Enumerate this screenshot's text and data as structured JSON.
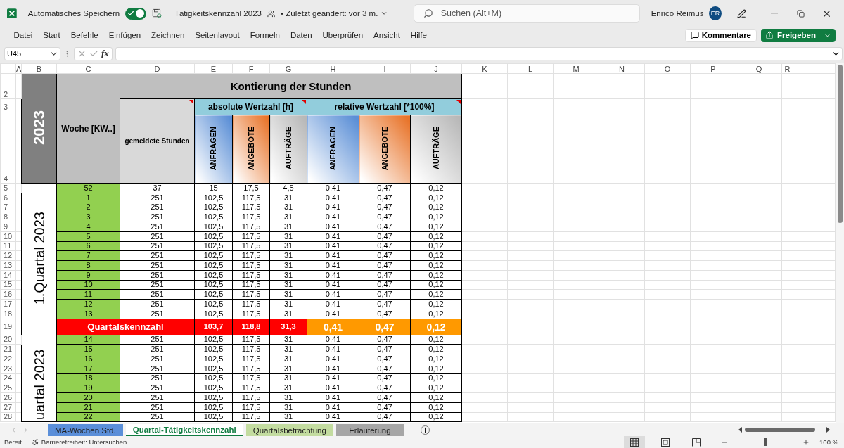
{
  "app": {
    "autosave_label": "Automatisches Speichern",
    "autosave_on": true,
    "document_title": "Tätigkeitskennzahl 2023",
    "modified": "• Zuletzt geändert: vor 3 m.",
    "search_placeholder": "Suchen (Alt+M)",
    "user_name": "Enrico Reimus",
    "user_initials": "ER"
  },
  "menu": [
    "Datei",
    "Start",
    "Befehle",
    "Einfügen",
    "Zeichnen",
    "Seitenlayout",
    "Formeln",
    "Daten",
    "Überprüfen",
    "Ansicht",
    "Hilfe"
  ],
  "ribbon_buttons": {
    "comments": "Kommentare",
    "share": "Freigeben"
  },
  "formula_bar": {
    "name_box": "U45",
    "function_label": "fx"
  },
  "column_headers": [
    "A",
    "B",
    "C",
    "D",
    "E",
    "F",
    "G",
    "H",
    "I",
    "J",
    "K",
    "L",
    "M",
    "N",
    "O",
    "P",
    "Q",
    "R"
  ],
  "sheet": {
    "header_rows": [
      "2",
      "3",
      "4"
    ],
    "year": "2023",
    "week_header": "Woche [KW..]",
    "title": "Kontierung der Stunden",
    "reported_header": {
      "label": "gemeldete Stunden",
      "comment": true
    },
    "group_headers": [
      {
        "label": "absolute Wertzahl [h]",
        "comment": true
      },
      {
        "label": "relative Wertzahl [*100%]",
        "comment": true
      }
    ],
    "sub_headers": [
      {
        "label": "ANFRAGEN",
        "kind": "blue"
      },
      {
        "label": "ANGEBOTE",
        "kind": "orange"
      },
      {
        "label": "AUFTRÄGE",
        "kind": "gray"
      },
      {
        "label": "ANFRAGEN",
        "kind": "blue"
      },
      {
        "label": "ANGEBOTE",
        "kind": "orange"
      },
      {
        "label": "AUFTRÄGE",
        "kind": "gray"
      }
    ],
    "quarters": [
      {
        "label": "1.Quartal 2023",
        "rows": [
          {
            "row": "5",
            "week": "52",
            "reported": "37",
            "values": [
              "15",
              "17,5",
              "4,5",
              "0,41",
              "0,47",
              "0,12"
            ]
          },
          {
            "row": "6",
            "week": "1",
            "reported": "251",
            "values": [
              "102,5",
              "117,5",
              "31",
              "0,41",
              "0,47",
              "0,12"
            ]
          },
          {
            "row": "7",
            "week": "2",
            "reported": "251",
            "values": [
              "102,5",
              "117,5",
              "31",
              "0,41",
              "0,47",
              "0,12"
            ]
          },
          {
            "row": "8",
            "week": "3",
            "reported": "251",
            "values": [
              "102,5",
              "117,5",
              "31",
              "0,41",
              "0,47",
              "0,12"
            ]
          },
          {
            "row": "9",
            "week": "4",
            "reported": "251",
            "values": [
              "102,5",
              "117,5",
              "31",
              "0,41",
              "0,47",
              "0,12"
            ]
          },
          {
            "row": "10",
            "week": "5",
            "reported": "251",
            "values": [
              "102,5",
              "117,5",
              "31",
              "0,41",
              "0,47",
              "0,12"
            ]
          },
          {
            "row": "11",
            "week": "6",
            "reported": "251",
            "values": [
              "102,5",
              "117,5",
              "31",
              "0,41",
              "0,47",
              "0,12"
            ]
          },
          {
            "row": "12",
            "week": "7",
            "reported": "251",
            "values": [
              "102,5",
              "117,5",
              "31",
              "0,41",
              "0,47",
              "0,12"
            ]
          },
          {
            "row": "13",
            "week": "8",
            "reported": "251",
            "values": [
              "102,5",
              "117,5",
              "31",
              "0,41",
              "0,47",
              "0,12"
            ]
          },
          {
            "row": "14",
            "week": "9",
            "reported": "251",
            "values": [
              "102,5",
              "117,5",
              "31",
              "0,41",
              "0,47",
              "0,12"
            ]
          },
          {
            "row": "15",
            "week": "10",
            "reported": "251",
            "values": [
              "102,5",
              "117,5",
              "31",
              "0,41",
              "0,47",
              "0,12"
            ]
          },
          {
            "row": "16",
            "week": "11",
            "reported": "251",
            "values": [
              "102,5",
              "117,5",
              "31",
              "0,41",
              "0,47",
              "0,12"
            ]
          },
          {
            "row": "17",
            "week": "12",
            "reported": "251",
            "values": [
              "102,5",
              "117,5",
              "31",
              "0,41",
              "0,47",
              "0,12"
            ]
          },
          {
            "row": "18",
            "week": "13",
            "reported": "251",
            "values": [
              "102,5",
              "117,5",
              "31",
              "0,41",
              "0,47",
              "0,12"
            ]
          }
        ],
        "summary": {
          "row": "19",
          "label": "Quartalskennzahl",
          "values": [
            "103,7",
            "118,8",
            "31,3",
            "0,41",
            "0,47",
            "0,12"
          ]
        }
      },
      {
        "label": "uartal 2023",
        "rows": [
          {
            "row": "20",
            "week": "14",
            "reported": "251",
            "values": [
              "102,5",
              "117,5",
              "31",
              "0,41",
              "0,47",
              "0,12"
            ]
          },
          {
            "row": "21",
            "week": "15",
            "reported": "251",
            "values": [
              "102,5",
              "117,5",
              "31",
              "0,41",
              "0,47",
              "0,12"
            ]
          },
          {
            "row": "22",
            "week": "16",
            "reported": "251",
            "values": [
              "102,5",
              "117,5",
              "31",
              "0,41",
              "0,47",
              "0,12"
            ]
          },
          {
            "row": "23",
            "week": "17",
            "reported": "251",
            "values": [
              "102,5",
              "117,5",
              "31",
              "0,41",
              "0,47",
              "0,12"
            ]
          },
          {
            "row": "24",
            "week": "18",
            "reported": "251",
            "values": [
              "102,5",
              "117,5",
              "31",
              "0,41",
              "0,47",
              "0,12"
            ]
          },
          {
            "row": "25",
            "week": "19",
            "reported": "251",
            "values": [
              "102,5",
              "117,5",
              "31",
              "0,41",
              "0,47",
              "0,12"
            ]
          },
          {
            "row": "26",
            "week": "20",
            "reported": "251",
            "values": [
              "102,5",
              "117,5",
              "31",
              "0,41",
              "0,47",
              "0,12"
            ]
          },
          {
            "row": "27",
            "week": "21",
            "reported": "251",
            "values": [
              "102,5",
              "117,5",
              "31",
              "0,41",
              "0,47",
              "0,12"
            ]
          },
          {
            "row": "28",
            "week": "22",
            "reported": "251",
            "values": [
              "102,5",
              "117,5",
              "31",
              "0,41",
              "0,47",
              "0,12"
            ]
          }
        ]
      }
    ]
  },
  "sheet_tabs": [
    {
      "label": "MA-Wochen Std.",
      "selected": false,
      "color": "#5b8fd9"
    },
    {
      "label": "Quartal-Tätigkeitskennzahl",
      "selected": true
    },
    {
      "label": "Quartalsbetrachtung",
      "selected": false,
      "color": "#c3dca0"
    },
    {
      "label": "Erläuterung",
      "selected": false,
      "color": "#a6a6a6"
    }
  ],
  "status_bar": {
    "ready": "Bereit",
    "accessibility": "Barrierefreiheit: Untersuchen",
    "views": [
      {
        "kind": "normal",
        "selected": true
      },
      {
        "kind": "page_layout",
        "selected": false
      },
      {
        "kind": "page_break",
        "selected": false
      }
    ],
    "zoom": {
      "level": 0.5,
      "reading": "100 %"
    }
  }
}
